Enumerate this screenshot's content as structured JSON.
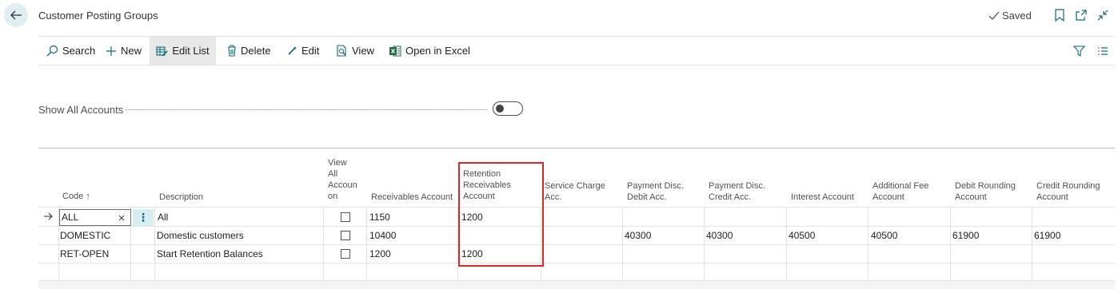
{
  "header": {
    "title": "Customer Posting Groups",
    "saved_label": "Saved"
  },
  "actions": {
    "search": "Search",
    "new": "New",
    "edit_list": "Edit List",
    "delete": "Delete",
    "edit": "Edit",
    "view": "View",
    "open_in_excel": "Open in Excel"
  },
  "toggle": {
    "label": "Show All Accounts",
    "on": false
  },
  "table": {
    "columns": {
      "code": "Code",
      "code_sort": "↑",
      "description": "Description",
      "view_all_accounts": [
        "View",
        "All",
        "Accoun",
        "on"
      ],
      "receivables": "Receivables Account",
      "retention": [
        "Retention",
        "Receivables",
        "Account"
      ],
      "service_charge": [
        "Service Charge",
        "Acc."
      ],
      "pmt_disc_debit": [
        "Payment Disc.",
        "Debit Acc."
      ],
      "pmt_disc_credit": [
        "Payment Disc.",
        "Credit Acc."
      ],
      "interest": "Interest Account",
      "additional_fee": [
        "Additional Fee",
        "Account"
      ],
      "debit_rounding": [
        "Debit Rounding",
        "Account"
      ],
      "credit_rounding": [
        "Credit Rounding",
        "Account"
      ]
    },
    "rows": [
      {
        "code": "ALL",
        "description": "All",
        "receivables": "1150",
        "retention": "1200",
        "pmt_disc_debit": "",
        "pmt_disc_credit": "",
        "interest": "",
        "additional_fee": "",
        "debit_rounding": "",
        "credit_rounding": ""
      },
      {
        "code": "DOMESTIC",
        "description": "Domestic customers",
        "receivables": "10400",
        "retention": "",
        "pmt_disc_debit": "40300",
        "pmt_disc_credit": "40300",
        "interest": "40500",
        "additional_fee": "40500",
        "debit_rounding": "61900",
        "credit_rounding": "61900"
      },
      {
        "code": "RET-OPEN",
        "description": "Start Retention Balances",
        "receivables": "1200",
        "retention": "1200",
        "pmt_disc_debit": "",
        "pmt_disc_credit": "",
        "interest": "",
        "additional_fee": "",
        "debit_rounding": "",
        "credit_rounding": ""
      }
    ]
  },
  "colors": {
    "accent": "#0b6a77",
    "highlight_border": "#d42a2a",
    "excel_green": "#1d6f42"
  }
}
